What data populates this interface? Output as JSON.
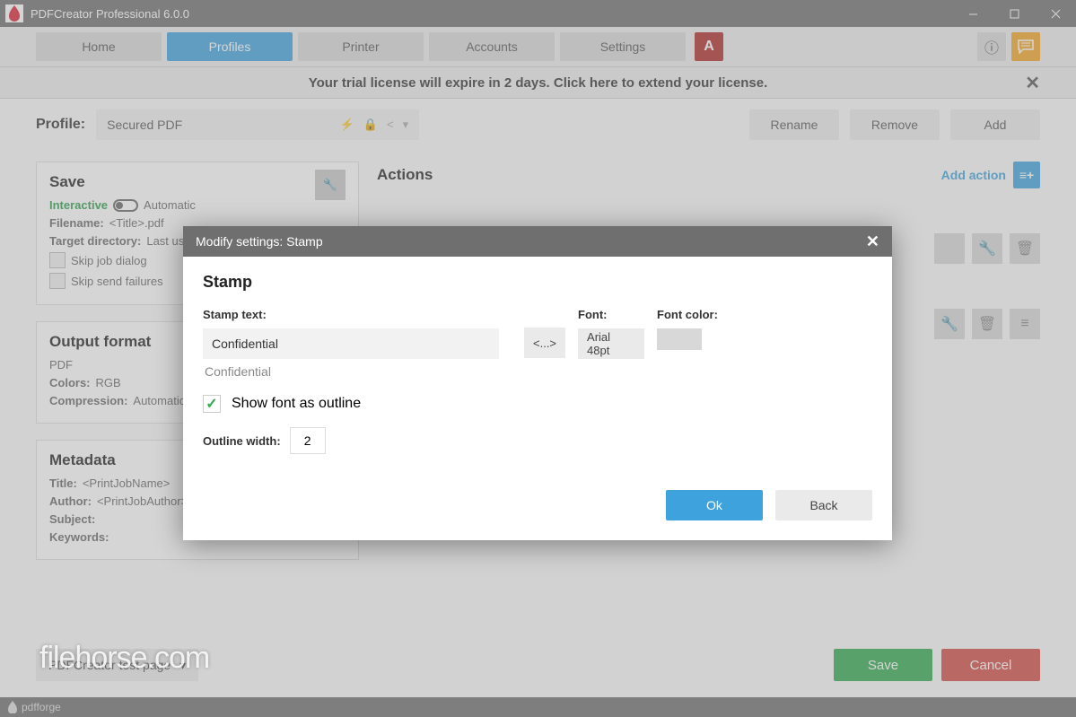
{
  "titlebar": {
    "title": "PDFCreator Professional 6.0.0"
  },
  "nav": {
    "home": "Home",
    "profiles": "Profiles",
    "printer": "Printer",
    "accounts": "Accounts",
    "settings": "Settings",
    "arch": "A"
  },
  "banner": {
    "text": "Your trial license will expire in 2 days. Click here to extend your license."
  },
  "profile": {
    "label": "Profile:",
    "selected": "Secured PDF",
    "rename": "Rename",
    "remove": "Remove",
    "add": "Add"
  },
  "save": {
    "heading": "Save",
    "interactive": "Interactive",
    "automatic": "Automatic",
    "filename_k": "Filename:",
    "filename_v": "<Title>.pdf",
    "target_k": "Target directory:",
    "target_v": "Last used d",
    "skipjob": "Skip job dialog",
    "skipsend": "Skip send failures"
  },
  "output": {
    "heading": "Output format",
    "fmt": "PDF",
    "colors_k": "Colors:",
    "colors_v": "RGB",
    "comp_k": "Compression:",
    "comp_v": "Automatic"
  },
  "meta": {
    "heading": "Metadata",
    "title_k": "Title:",
    "title_v": "<PrintJobName>",
    "author_k": "Author:",
    "author_v": "<PrintJobAuthor>",
    "subject_k": "Subject:",
    "keywords_k": "Keywords:"
  },
  "actions": {
    "heading": "Actions",
    "add": "Add action"
  },
  "bottom": {
    "testpage": "PDFCreator test page",
    "save": "Save",
    "cancel": "Cancel"
  },
  "status": {
    "brand": "pdfforge"
  },
  "watermark": "filehorse.com",
  "modal": {
    "title": "Modify settings: Stamp",
    "heading": "Stamp",
    "stamptext_l": "Stamp text:",
    "stamptext_v": "Confidential",
    "preview": "Confidential",
    "font_l": "Font:",
    "font_v": "Arial 48pt",
    "fontcolor_l": "Font color:",
    "token": "<...>",
    "outline_cb": "Show font as outline",
    "ow_l": "Outline width:",
    "ow_v": "2",
    "ok": "Ok",
    "back": "Back"
  }
}
